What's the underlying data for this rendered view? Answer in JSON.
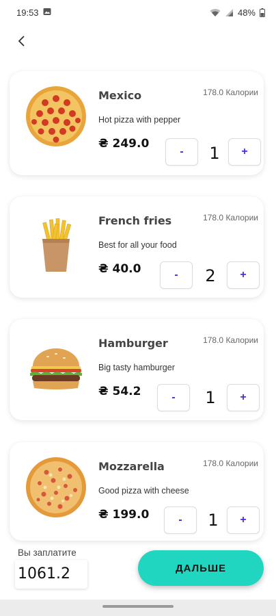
{
  "status_bar": {
    "time": "19:53",
    "battery": "48%"
  },
  "currency": "₴",
  "items": [
    {
      "name": "Mexico",
      "calories": "178.0 Калории",
      "description": "Hot pizza with pepper",
      "price": "₴ 249.0",
      "minus": "-",
      "plus": "+",
      "quantity": "1",
      "icon": "pepperoni-pizza-icon"
    },
    {
      "name": "French fries",
      "calories": "178.0 Калории",
      "description": "Best for all your food",
      "price": "₴ 40.0",
      "minus": "-",
      "plus": "+",
      "quantity": "2",
      "icon": "french-fries-icon"
    },
    {
      "name": "Hamburger",
      "calories": "178.0 Калории",
      "description": "Big tasty hamburger",
      "price": "₴ 54.2",
      "minus": "-",
      "plus": "+",
      "quantity": "1",
      "icon": "hamburger-icon"
    },
    {
      "name": "Mozzarella",
      "calories": "178.0 Калории",
      "description": "Good pizza with cheese",
      "price": "₴ 199.0",
      "minus": "-",
      "plus": "+",
      "quantity": "1",
      "icon": "cheese-pizza-icon"
    }
  ],
  "footer": {
    "pay_label": "Вы заплатите",
    "total": "1061.2",
    "next_label": "ДАЛЬШЕ"
  },
  "colors": {
    "accent": "#20d6c0",
    "button_text": "#4b2bd6"
  }
}
